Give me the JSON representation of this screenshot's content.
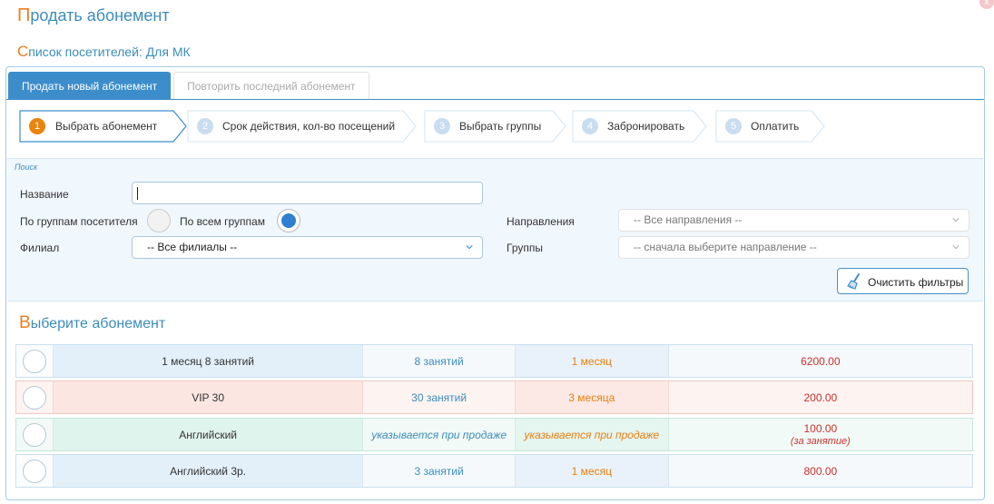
{
  "header": {
    "title_first": "П",
    "title_rest": "родать абонемент",
    "close_glyph": "x"
  },
  "subheader": {
    "first": "С",
    "rest": "писок посетителей: Для МК"
  },
  "tabs": [
    {
      "label": "Продать новый абонемент",
      "active": true
    },
    {
      "label": "Повторить последний абонемент",
      "active": false
    }
  ],
  "steps": [
    {
      "num": "1",
      "label": "Выбрать абонемент",
      "active": true
    },
    {
      "num": "2",
      "label": "Срок действия, кол-во посещений",
      "active": false
    },
    {
      "num": "3",
      "label": "Выбрать группы",
      "active": false
    },
    {
      "num": "4",
      "label": "Забронировать",
      "active": false
    },
    {
      "num": "5",
      "label": "Оплатить",
      "active": false
    }
  ],
  "filters": {
    "legend": "Поиск",
    "name_label": "Название",
    "name_value": "",
    "by_visitor_groups": "По группам посетителя",
    "by_all_groups": "По всем группам",
    "selected_group_mode": "По всем группам",
    "branch_label": "Филиал",
    "branch_value": "-- Все филиалы --",
    "direction_label": "Направления",
    "direction_value": "-- Все направления --",
    "groups_label": "Группы",
    "groups_value": "-- сначала выберите направление --",
    "clear_button": "Очистить фильтры"
  },
  "choose": {
    "first": "В",
    "rest": "ыберите абонемент"
  },
  "subscriptions": [
    {
      "name": "1 месяц 8 занятий",
      "visits": "8 занятий",
      "period": "1 месяц",
      "price": "6200.00",
      "price_note": "",
      "style": "blue"
    },
    {
      "name": "VIP 30",
      "visits": "30 занятий",
      "period": "3 месяца",
      "price": "200.00",
      "price_note": "",
      "style": "red"
    },
    {
      "name": "Английский",
      "visits": "указывается при продаже",
      "period": "указывается при продаже",
      "price": "100.00",
      "price_note": "(за занятие)",
      "style": "green"
    },
    {
      "name": "Английский 3р.",
      "visits": "3 занятий",
      "period": "1 месяц",
      "price": "800.00",
      "price_note": "",
      "style": "blue"
    }
  ],
  "colors": {
    "accent": "#3c8dca",
    "cap_orange": "#f07d1a",
    "price_red": "#c9302c",
    "step_active": "#e8850f"
  }
}
